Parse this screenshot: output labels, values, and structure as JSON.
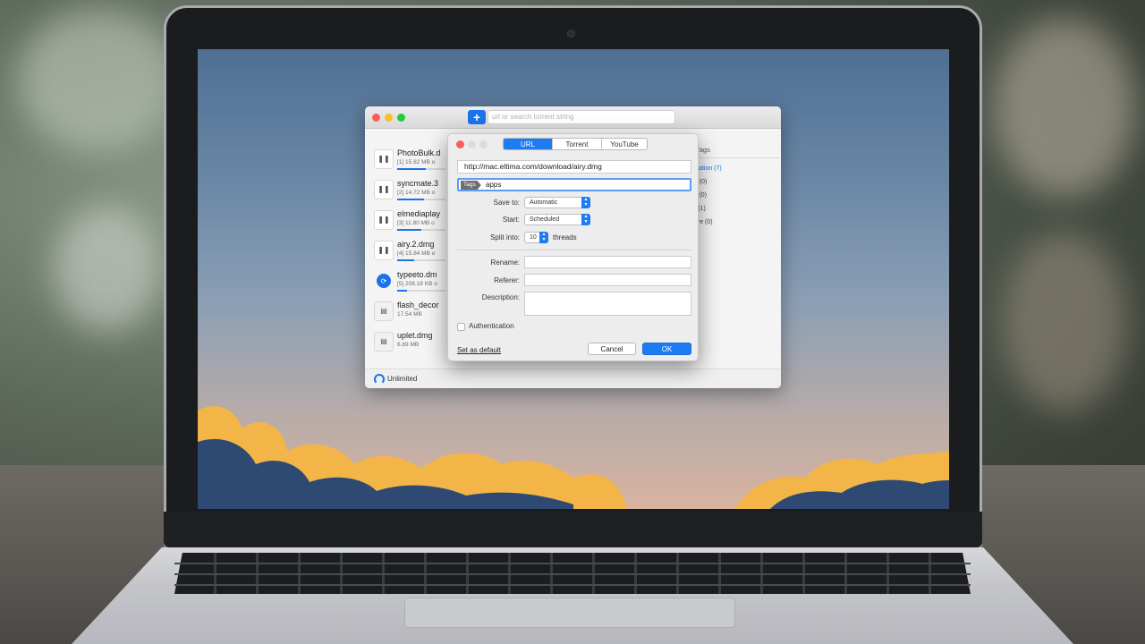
{
  "app": {
    "search": {
      "placeholder": "url or search torrent string",
      "add_label": "+"
    },
    "downloads": [
      {
        "name": "PhotoBulk.d",
        "meta": "[1] 15.82 MB o",
        "state": "paused",
        "progress": 0.6
      },
      {
        "name": "syncmate.3",
        "meta": "[2] 14.72 MB o",
        "state": "paused",
        "progress": 0.55
      },
      {
        "name": "elmediaplay",
        "meta": "[3] 11.80 MB o",
        "state": "paused",
        "progress": 0.5
      },
      {
        "name": "airy.2.dmg",
        "meta": "[4] 15.84 MB o",
        "state": "paused",
        "progress": 0.35
      },
      {
        "name": "typeeto.dm",
        "meta": "[5] 208.18 KB o",
        "state": "loading",
        "progress": 0.2
      },
      {
        "name": "flash_decor",
        "meta": "17.54 MB",
        "state": "file",
        "progress": null
      },
      {
        "name": "uplet.dmg",
        "meta": "6.89 MB",
        "state": "file",
        "progress": null
      }
    ],
    "speed_label": "Unlimited",
    "tags": {
      "title": "Tags",
      "items": [
        {
          "label": "ication (7)",
          "active": true
        },
        {
          "label": "e (0)",
          "active": false
        },
        {
          "label": "c (0)",
          "active": false
        },
        {
          "label": "r (1)",
          "active": false
        },
        {
          "label": "ure (0)",
          "active": false
        }
      ]
    }
  },
  "dialog": {
    "tabs": [
      {
        "label": "URL",
        "active": true
      },
      {
        "label": "Torrent",
        "active": false
      },
      {
        "label": "YouTube",
        "active": false
      }
    ],
    "url_value": "http://mac.eltima.com/download/airy.dmg",
    "tags_chip": "Tags",
    "tags_value": "apps",
    "save_to": {
      "label": "Save to:",
      "value": "Automatic"
    },
    "start": {
      "label": "Start:",
      "value": "Scheduled"
    },
    "split": {
      "label": "Split into:",
      "value": "10",
      "suffix": "threads"
    },
    "rename_label": "Rename:",
    "referer_label": "Referer:",
    "description_label": "Description:",
    "authentication_label": "Authentication",
    "set_default_label": "Set as default",
    "cancel_label": "Cancel",
    "ok_label": "OK"
  },
  "colors": {
    "accent": "#1e7cf2",
    "close": "#fc5f57",
    "minimize": "#fdbc2e",
    "zoom": "#28c840"
  }
}
